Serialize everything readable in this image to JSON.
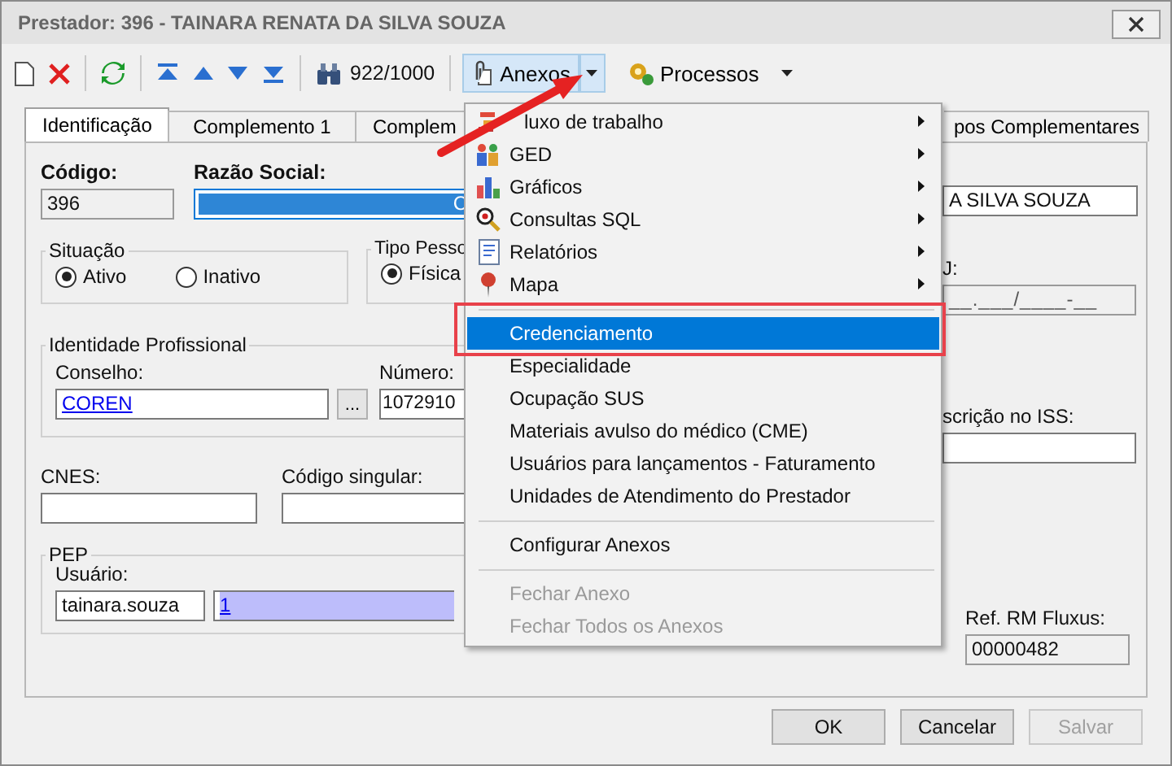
{
  "window": {
    "title": "Prestador: 396 - TAINARA RENATA DA SILVA SOUZA"
  },
  "toolbar": {
    "record_counter": "922/1000",
    "anexos_button": "Anexos",
    "anexos_pressed": true,
    "processos_button": "Processos"
  },
  "tabs": [
    {
      "label": "Identificação",
      "selected": true
    },
    {
      "label": "Complemento 1",
      "selected": false
    },
    {
      "label": "Complem",
      "selected": false
    },
    {
      "label": "pos Complementares",
      "selected": false
    }
  ],
  "form": {
    "codigo_label": "Código:",
    "codigo_value": "396",
    "razao_label": "Razão Social:",
    "razao_value": "C",
    "razao_right_value": "A SILVA SOUZA",
    "situacao": {
      "legend": "Situação",
      "options": [
        {
          "label": "Ativo",
          "selected": true
        },
        {
          "label": "Inativo",
          "selected": false
        }
      ]
    },
    "tipo_pessoa": {
      "legend": "Tipo Pesso",
      "options": [
        {
          "label": "Física",
          "selected": true
        }
      ]
    },
    "cnpj_label": "J:",
    "cnpj_value": "__.___/____-__",
    "identidade": {
      "legend": "Identidade Profissional",
      "conselho_label": "Conselho:",
      "conselho_value": "COREN",
      "browse_button": "...",
      "numero_label": "Número:",
      "numero_value": "1072910"
    },
    "iss_label": "scrição no ISS:",
    "cnes_label": "CNES:",
    "codigo_singular_label": "Código singular:",
    "pep": {
      "legend": "PEP",
      "usuario_label": "Usuário:",
      "usuario_value": "tainara.souza",
      "usuario_link": "1"
    },
    "ref_label": "Ref. RM Fluxus:",
    "ref_value": "00000482"
  },
  "menu": {
    "items": [
      {
        "kind": "submenu",
        "label": "luxo de trabalho",
        "disabled": false,
        "highlighted": false
      },
      {
        "kind": "submenu",
        "label": "GED",
        "disabled": false,
        "highlighted": false
      },
      {
        "kind": "submenu",
        "label": "Gráficos",
        "disabled": false,
        "highlighted": false
      },
      {
        "kind": "submenu",
        "label": "Consultas SQL",
        "disabled": false,
        "highlighted": false
      },
      {
        "kind": "submenu",
        "label": "Relatórios",
        "disabled": false,
        "highlighted": false
      },
      {
        "kind": "submenu",
        "label": "Mapa",
        "disabled": false,
        "highlighted": false
      },
      {
        "kind": "separator"
      },
      {
        "kind": "item",
        "label": "Credenciamento",
        "disabled": false,
        "highlighted": true
      },
      {
        "kind": "item",
        "label": "Especialidade",
        "disabled": false,
        "highlighted": false
      },
      {
        "kind": "item",
        "label": "Ocupação SUS",
        "disabled": false,
        "highlighted": false
      },
      {
        "kind": "item",
        "label": "Materiais avulso do médico (CME)",
        "disabled": false,
        "highlighted": false
      },
      {
        "kind": "item",
        "label": "Usuários para lançamentos - Faturamento",
        "disabled": false,
        "highlighted": false
      },
      {
        "kind": "item",
        "label": "Unidades de Atendimento do Prestador",
        "disabled": false,
        "highlighted": false
      },
      {
        "kind": "separator"
      },
      {
        "kind": "item",
        "label": "Configurar Anexos",
        "disabled": false,
        "highlighted": false
      },
      {
        "kind": "separator"
      },
      {
        "kind": "item",
        "label": "Fechar Anexo",
        "disabled": true,
        "highlighted": false
      },
      {
        "kind": "item",
        "label": "Fechar Todos os Anexos",
        "disabled": true,
        "highlighted": false
      }
    ]
  },
  "buttons": [
    {
      "label": "OK",
      "disabled": false
    },
    {
      "label": "Cancelar",
      "disabled": false
    },
    {
      "label": "Salvar",
      "disabled": true
    }
  ]
}
